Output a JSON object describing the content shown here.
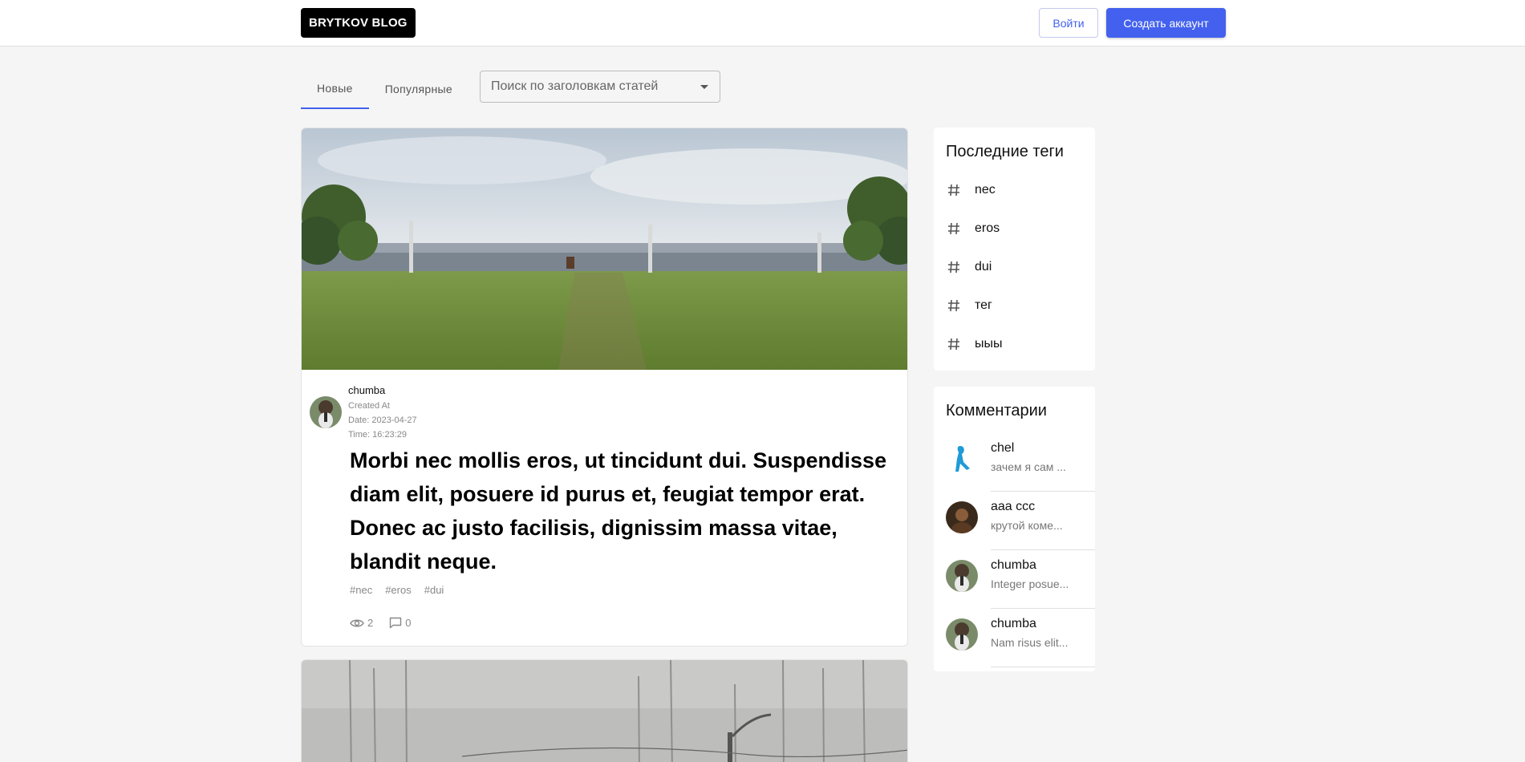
{
  "header": {
    "logo": "BRYTKOV BLOG",
    "login_label": "Войти",
    "register_label": "Создать аккаунт"
  },
  "tabs": [
    {
      "label": "Новые",
      "active": true
    },
    {
      "label": "Популярные",
      "active": false
    }
  ],
  "search": {
    "placeholder": "Поиск по заголовкам статей"
  },
  "post": {
    "author": "chumba",
    "created_label": "Created At",
    "date": "Date: 2023-04-27",
    "time": "Time: 16:23:29",
    "title": "Morbi nec mollis eros, ut tincidunt dui. Suspendisse diam elit, posuere id purus et, feugiat tempor erat. Donec ac justo facilisis, dignissim massa vitae, blandit neque.",
    "tags": [
      "#nec",
      "#eros",
      "#dui"
    ],
    "views": "2",
    "comments": "0"
  },
  "sidebar": {
    "tags_title": "Последние теги",
    "tags": [
      "nec",
      "eros",
      "dui",
      "тег",
      "ыыы"
    ],
    "comments_title": "Комментарии",
    "comments": [
      {
        "name": "chel",
        "text": "зачем я сам ..."
      },
      {
        "name": "aaa ccc",
        "text": "крутой коме..."
      },
      {
        "name": "chumba",
        "text": "Integer posue..."
      },
      {
        "name": "chumba",
        "text": "Nam risus elit..."
      }
    ]
  },
  "colors": {
    "accent": "#4361ee",
    "background": "#f5f5f5"
  }
}
